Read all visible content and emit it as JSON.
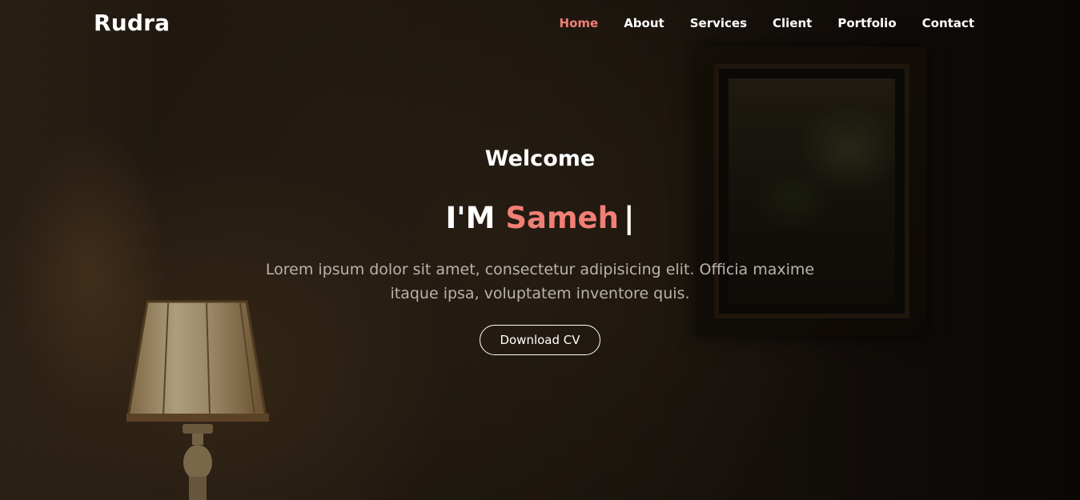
{
  "brand": {
    "name": "Rudra"
  },
  "nav": {
    "items": [
      {
        "label": "Home",
        "active": true
      },
      {
        "label": "About",
        "active": false
      },
      {
        "label": "Services",
        "active": false
      },
      {
        "label": "Client",
        "active": false
      },
      {
        "label": "Portfolio",
        "active": false
      },
      {
        "label": "Contact",
        "active": false
      }
    ]
  },
  "hero": {
    "welcome": "Welcome",
    "headline_prefix": "I'M",
    "headline_name": "Sameh",
    "cursor": "|",
    "description": "Lorem ipsum dolor sit amet, consectetur adipisicing elit. Officia maxime itaque ipsa, voluptatem inventore quis.",
    "button_label": "Download CV"
  },
  "colors": {
    "accent": "#f07f75",
    "text": "#ffffff",
    "muted_text": "#b9b3ad",
    "background": "#1e1710"
  }
}
